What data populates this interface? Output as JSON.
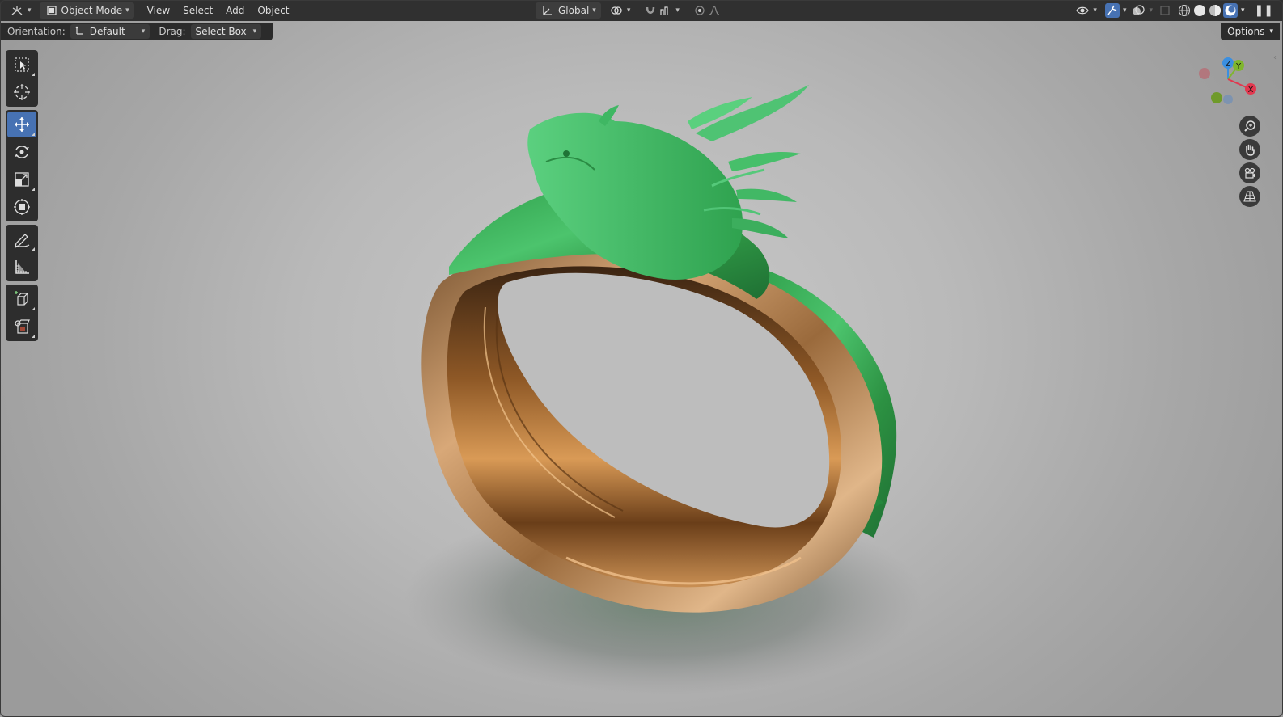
{
  "header": {
    "editor_type_icon": "3d-viewport-icon",
    "mode": {
      "icon": "object-mode-icon",
      "label": "Object Mode"
    },
    "menus": [
      "View",
      "Select",
      "Add",
      "Object"
    ],
    "transform_orientation": {
      "icon": "orientation-icon",
      "label": "Global"
    },
    "right_icons": [
      "visibility-icon",
      "gizmo-icon",
      "overlay-icon",
      "xray-icon",
      "wireframe-shading-icon",
      "solid-shading-icon",
      "material-shading-icon",
      "rendered-shading-icon"
    ]
  },
  "tool_settings": {
    "orientation_label": "Orientation:",
    "orientation_value": "Default",
    "drag_label": "Drag:",
    "drag_value": "Select Box",
    "options_label": "Options"
  },
  "toolbar": {
    "groups": [
      [
        "select-box-tool",
        "cursor-tool"
      ],
      [
        "move-tool",
        "rotate-tool",
        "scale-tool",
        "transform-tool"
      ],
      [
        "annotate-tool",
        "measure-tool"
      ],
      [
        "add-cube-tool",
        "add-object-tool"
      ]
    ],
    "active_tool": "move-tool"
  },
  "navigation": {
    "axes": {
      "x": "X",
      "y": "Y",
      "z": "Z"
    },
    "buttons": [
      "zoom-icon",
      "pan-hand-icon",
      "camera-view-icon",
      "perspective-grid-icon"
    ]
  },
  "colors": {
    "header_bg": "#303030",
    "accent_blue": "#4772b3",
    "viewport_bg": "#b9b9b9",
    "jade_green": "#3fbf63",
    "gold": "#b8834a",
    "axis_x": "#e2384f",
    "axis_y": "#7fb62c",
    "axis_z": "#3b8fe0"
  }
}
